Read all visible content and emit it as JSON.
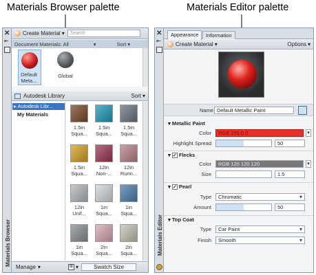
{
  "captions": {
    "left": "Materials Browser palette",
    "right": "Materials Editor palette"
  },
  "browser": {
    "title": "Materials Browser",
    "create_material": "Create Material",
    "search_placeholder": "Search",
    "doc_materials_label": "Document Materials: All",
    "sort_label": "Sort",
    "doc_materials": [
      {
        "label": "Default Meta...",
        "color": "#c8191e"
      },
      {
        "label": "Global",
        "color": "#555a5e"
      }
    ],
    "library_label": "Autodesk Library",
    "library_sort": "Sort",
    "tree": {
      "item1": "Autodesk Libr...",
      "item2": "My Materials"
    },
    "swatches": [
      {
        "label": "1.5in Squa...",
        "color": "#7a4a2c"
      },
      {
        "label": "1.5in Squa...",
        "color": "#1f9ab8"
      },
      {
        "label": "1.5in Squa...",
        "color": "#6a7684"
      },
      {
        "label": "1.5in Squa...",
        "color": "#d6a228"
      },
      {
        "label": "12in Non-...",
        "color": "#9c3a52"
      },
      {
        "label": "12in Runn...",
        "color": "#b8838a"
      },
      {
        "label": "12in Unif...",
        "color": "#b4b8bc"
      },
      {
        "label": "1in Squa...",
        "color": "#d4d8dc"
      },
      {
        "label": "1in Squa...",
        "color": "#4c7fae"
      },
      {
        "label": "1in Squa...",
        "color": "#8c9094"
      },
      {
        "label": "2in Squa...",
        "color": "#d8a8b0"
      },
      {
        "label": "2in Squa...",
        "color": "#c4c2b4"
      }
    ],
    "swatch_row_labels": [
      [
        "1.5in",
        "Squa..."
      ],
      [
        "1.5in",
        "Squa..."
      ],
      [
        "1.5in",
        "Squa..."
      ],
      [
        "1.5in",
        "Squa..."
      ],
      [
        "12in",
        "Non-..."
      ],
      [
        "12in",
        "Runn..."
      ],
      [
        "12in",
        "Unif..."
      ],
      [
        "1in",
        "Squa..."
      ],
      [
        "1in",
        "Squa..."
      ],
      [
        "1in",
        "Squa..."
      ],
      [
        "2in",
        "Squa..."
      ],
      [
        "2in",
        "Squa..."
      ]
    ],
    "manage_label": "Manage",
    "swatch_size_label": "Swatch Size"
  },
  "editor": {
    "title": "Materials Editor",
    "tabs": [
      "Appearance",
      "Information"
    ],
    "create_material": "Create Material",
    "options_label": "Options",
    "name_label": "Name",
    "name_value": "Default Metallic Paint",
    "sections": {
      "metallic": {
        "title": "Metallic Paint",
        "color_label": "Color",
        "color_value": "RGB 255 0 0",
        "color_hex": "#e8302a",
        "highlight_label": "Highlight Spread",
        "highlight_value": "50",
        "highlight_fraction": 0.5
      },
      "flecks": {
        "title": "Flecks",
        "color_label": "Color",
        "color_value": "RGB 120 120 120",
        "color_hex": "#787878",
        "size_label": "Size",
        "size_value": "1.5"
      },
      "pearl": {
        "title": "Pearl",
        "type_label": "Type",
        "type_value": "Chromatic",
        "amount_label": "Amount",
        "amount_value": "50",
        "amount_fraction": 0.5
      },
      "topcoat": {
        "title": "Top Coat",
        "type_label": "Type",
        "type_value": "Car Paint",
        "finish_label": "Finish",
        "finish_value": "Smooth"
      }
    }
  }
}
